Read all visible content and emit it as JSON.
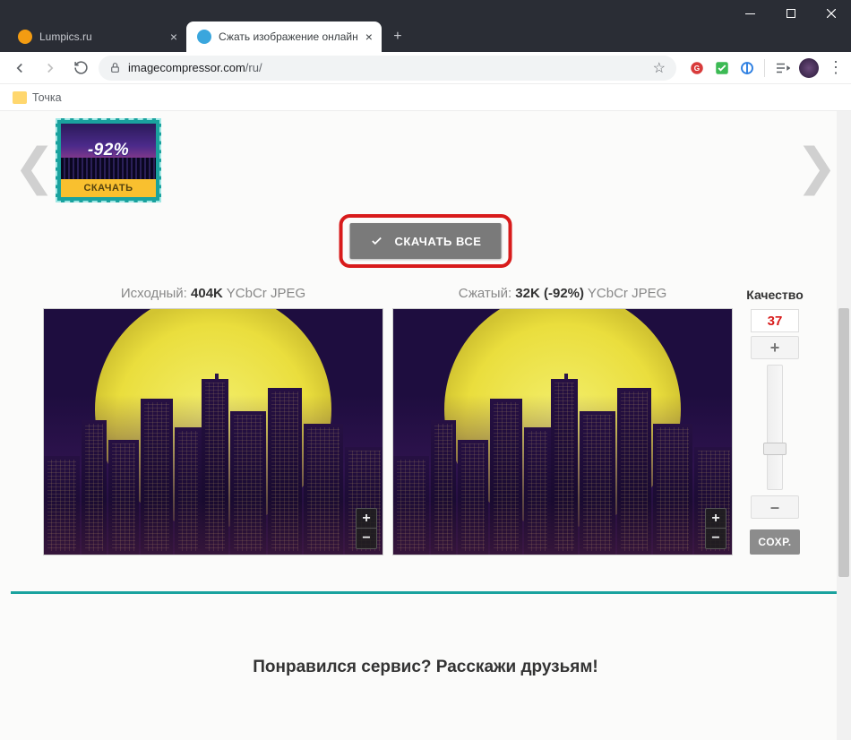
{
  "tabs": [
    {
      "title": "Lumpics.ru",
      "favicon_color": "#f39c12"
    },
    {
      "title": "Сжать изображение онлайн",
      "favicon_color": "#3aa6dd"
    }
  ],
  "url_host": "imagecompressor.com",
  "url_path": "/ru/",
  "bookmark_folder": "Точка",
  "thumb": {
    "badge": "-92%",
    "download": "СКАЧАТЬ"
  },
  "download_all": "СКАЧАТЬ ВСЕ",
  "original": {
    "label": "Исходный:",
    "size": "404K",
    "meta": "YCbCr JPEG"
  },
  "compressed": {
    "label": "Сжатый:",
    "size": "32K",
    "pct": "(-92%)",
    "meta": "YCbCr JPEG"
  },
  "quality": {
    "label": "Качество",
    "value": "37",
    "plus": "+",
    "minus": "–",
    "save": "СОХР."
  },
  "footer": "Понравился сервис? Расскажи друзьям!"
}
